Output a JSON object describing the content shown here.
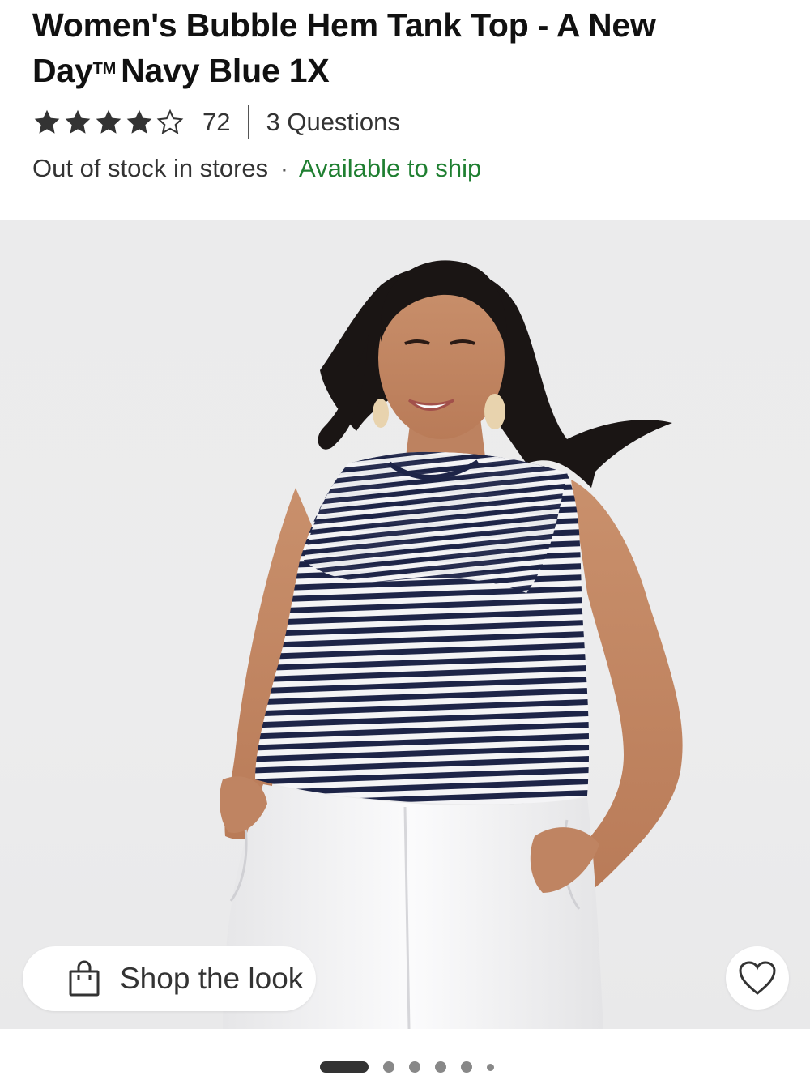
{
  "product": {
    "title_main": "Women's Bubble Hem Tank Top - A New Day",
    "title_tm": "TM",
    "title_tail": "Navy Blue 1X",
    "rating": {
      "stars_filled": 4,
      "stars_total": 5,
      "count": "72",
      "questions_label": "3 Questions"
    },
    "availability": {
      "in_store": "Out of stock in stores",
      "separator": "·",
      "shipping": "Available to ship"
    }
  },
  "gallery": {
    "shop_look_label": "Shop the look",
    "shop_look_icon": "shopping-bag-icon",
    "favorite_icon": "heart-outline-icon",
    "pagination": {
      "total": 6,
      "active_index": 0
    }
  },
  "colors": {
    "shipping_green": "#1f7f31",
    "text": "#333333",
    "title": "#111111",
    "image_bg": "#ececed"
  }
}
